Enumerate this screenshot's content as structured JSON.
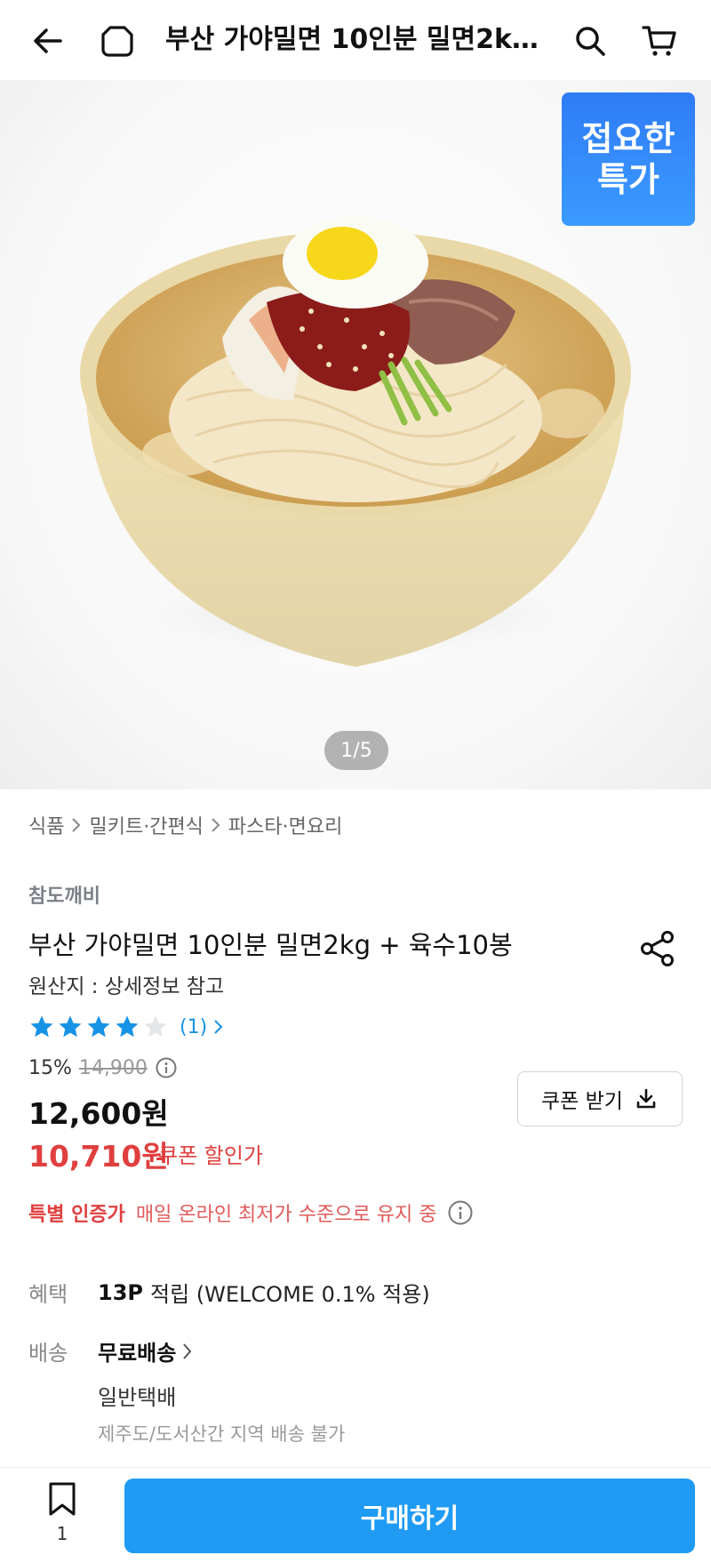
{
  "header": {
    "title": "부산 가야밀면 10인분 밀면2k…",
    "icons": [
      "back-arrow-icon",
      "home-icon",
      "search-icon",
      "cart-icon"
    ]
  },
  "hero": {
    "badge_line1": "접요한",
    "badge_line2": "특가",
    "pager": "1/5"
  },
  "breadcrumb": [
    "식품",
    "밀키트·간편식",
    "파스타·면요리"
  ],
  "product": {
    "brand": "참도깨비",
    "name": "부산 가야밀면 10인분 밀면2kg + 육수10봉",
    "origin": "원산지 : 상세정보 참고",
    "rating": 4,
    "rating_max": 5,
    "review_count": "(1)"
  },
  "price": {
    "discount_rate": "15%",
    "original_price": "14,900",
    "sale_price": "12,600원",
    "coupon_price": "10,710원",
    "coupon_price_label": "쿠폰 할인가",
    "coupon_button": "쿠폰 받기"
  },
  "special": {
    "label": "특별 인증가",
    "description": "매일 온라인 최저가 수준으로 유지 중"
  },
  "benefit": {
    "label": "혜택",
    "points": "13P",
    "text": "적립 (WELCOME 0.1% 적용)"
  },
  "shipping": {
    "label": "배송",
    "value": "무료배송",
    "type": "일반택배",
    "note": "제주도/도서산간 지역 배송 불가"
  },
  "bottom": {
    "wishlist_count": "1",
    "buy_label": "구매하기"
  },
  "colors": {
    "accent_blue": "#1f9bf4",
    "price_red": "#e03f3f",
    "star_blue": "#1793e6"
  }
}
